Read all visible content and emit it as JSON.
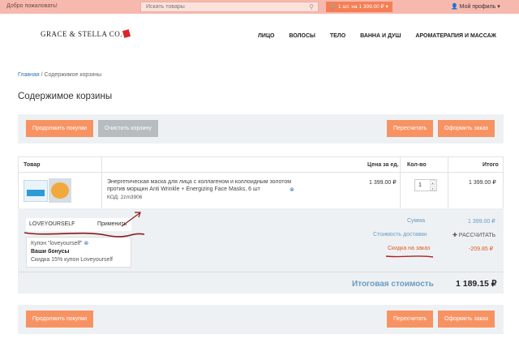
{
  "topbar": {
    "welcome": "Добро пожаловать!",
    "search_placeholder": "Искать товары",
    "cart": "1 шт. на 1 399.00 ₽ ▾",
    "profile": "Мой профиль ▾"
  },
  "header": {
    "logo": "GRACE & STELLA CO.",
    "nav": [
      "ЛИЦО",
      "ВОЛОСЫ",
      "ТЕЛО",
      "ВАННА И ДУШ",
      "АРОМАТЕРАПИЯ И МАССАЖ"
    ]
  },
  "breadcrumb": {
    "home": "Главная",
    "sep": "/",
    "current": "Содержимое корзины"
  },
  "page_title": "Содержимое корзины",
  "actions": {
    "continue": "Продолжить покупки",
    "clear": "Очистить корзину",
    "recalc": "Пересчитать",
    "checkout": "Оформить заказ"
  },
  "table": {
    "headers": {
      "product": "Товар",
      "price": "Цена за ед.",
      "qty": "Кол-во",
      "total": "Итого"
    },
    "item": {
      "name_line1": "Энергетическая маска для лица с коллагеном и коллоидным золотом",
      "name_line2": "против морщин Anti Wrinkle + Energizing Face Masks, 6 шт",
      "code": "КОД: 2zm3906",
      "price": "1 399.00 ₽",
      "qty": "1",
      "total": "1 399.00 ₽"
    }
  },
  "coupon": {
    "code": "LOVEYOURSELF",
    "apply": "Применить",
    "applied": "Купон \"loveyourself\"",
    "bonus_title": "Ваши бонусы",
    "bonus_desc": "Скидка 15% купон Loveyourself"
  },
  "summary": {
    "sum_label": "Сумма",
    "sum_value": "1 399.00 ₽",
    "shipping_label": "Стоимость доставки",
    "shipping_value": "✚ РАССЧИТАТЬ",
    "discount_label": "Скидка на заказ",
    "discount_value": "-209.85 ₽",
    "total_label": "Итоговая стоимость",
    "total_value": "1 189.15 ₽"
  },
  "colors": {
    "accent": "#f79362",
    "topbar": "#f7b9ad",
    "link": "#2e74b5",
    "annotation": "#8b1a1a"
  }
}
